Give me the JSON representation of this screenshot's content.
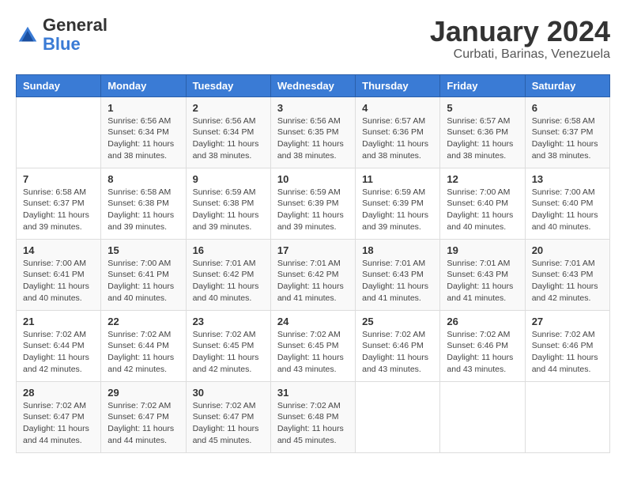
{
  "header": {
    "logo_general": "General",
    "logo_blue": "Blue",
    "month_title": "January 2024",
    "location": "Curbati, Barinas, Venezuela"
  },
  "weekdays": [
    "Sunday",
    "Monday",
    "Tuesday",
    "Wednesday",
    "Thursday",
    "Friday",
    "Saturday"
  ],
  "weeks": [
    [
      {
        "day": "",
        "info": ""
      },
      {
        "day": "1",
        "info": "Sunrise: 6:56 AM\nSunset: 6:34 PM\nDaylight: 11 hours\nand 38 minutes."
      },
      {
        "day": "2",
        "info": "Sunrise: 6:56 AM\nSunset: 6:34 PM\nDaylight: 11 hours\nand 38 minutes."
      },
      {
        "day": "3",
        "info": "Sunrise: 6:56 AM\nSunset: 6:35 PM\nDaylight: 11 hours\nand 38 minutes."
      },
      {
        "day": "4",
        "info": "Sunrise: 6:57 AM\nSunset: 6:36 PM\nDaylight: 11 hours\nand 38 minutes."
      },
      {
        "day": "5",
        "info": "Sunrise: 6:57 AM\nSunset: 6:36 PM\nDaylight: 11 hours\nand 38 minutes."
      },
      {
        "day": "6",
        "info": "Sunrise: 6:58 AM\nSunset: 6:37 PM\nDaylight: 11 hours\nand 38 minutes."
      }
    ],
    [
      {
        "day": "7",
        "info": "Sunrise: 6:58 AM\nSunset: 6:37 PM\nDaylight: 11 hours\nand 39 minutes."
      },
      {
        "day": "8",
        "info": "Sunrise: 6:58 AM\nSunset: 6:38 PM\nDaylight: 11 hours\nand 39 minutes."
      },
      {
        "day": "9",
        "info": "Sunrise: 6:59 AM\nSunset: 6:38 PM\nDaylight: 11 hours\nand 39 minutes."
      },
      {
        "day": "10",
        "info": "Sunrise: 6:59 AM\nSunset: 6:39 PM\nDaylight: 11 hours\nand 39 minutes."
      },
      {
        "day": "11",
        "info": "Sunrise: 6:59 AM\nSunset: 6:39 PM\nDaylight: 11 hours\nand 39 minutes."
      },
      {
        "day": "12",
        "info": "Sunrise: 7:00 AM\nSunset: 6:40 PM\nDaylight: 11 hours\nand 40 minutes."
      },
      {
        "day": "13",
        "info": "Sunrise: 7:00 AM\nSunset: 6:40 PM\nDaylight: 11 hours\nand 40 minutes."
      }
    ],
    [
      {
        "day": "14",
        "info": "Sunrise: 7:00 AM\nSunset: 6:41 PM\nDaylight: 11 hours\nand 40 minutes."
      },
      {
        "day": "15",
        "info": "Sunrise: 7:00 AM\nSunset: 6:41 PM\nDaylight: 11 hours\nand 40 minutes."
      },
      {
        "day": "16",
        "info": "Sunrise: 7:01 AM\nSunset: 6:42 PM\nDaylight: 11 hours\nand 40 minutes."
      },
      {
        "day": "17",
        "info": "Sunrise: 7:01 AM\nSunset: 6:42 PM\nDaylight: 11 hours\nand 41 minutes."
      },
      {
        "day": "18",
        "info": "Sunrise: 7:01 AM\nSunset: 6:43 PM\nDaylight: 11 hours\nand 41 minutes."
      },
      {
        "day": "19",
        "info": "Sunrise: 7:01 AM\nSunset: 6:43 PM\nDaylight: 11 hours\nand 41 minutes."
      },
      {
        "day": "20",
        "info": "Sunrise: 7:01 AM\nSunset: 6:43 PM\nDaylight: 11 hours\nand 42 minutes."
      }
    ],
    [
      {
        "day": "21",
        "info": "Sunrise: 7:02 AM\nSunset: 6:44 PM\nDaylight: 11 hours\nand 42 minutes."
      },
      {
        "day": "22",
        "info": "Sunrise: 7:02 AM\nSunset: 6:44 PM\nDaylight: 11 hours\nand 42 minutes."
      },
      {
        "day": "23",
        "info": "Sunrise: 7:02 AM\nSunset: 6:45 PM\nDaylight: 11 hours\nand 42 minutes."
      },
      {
        "day": "24",
        "info": "Sunrise: 7:02 AM\nSunset: 6:45 PM\nDaylight: 11 hours\nand 43 minutes."
      },
      {
        "day": "25",
        "info": "Sunrise: 7:02 AM\nSunset: 6:46 PM\nDaylight: 11 hours\nand 43 minutes."
      },
      {
        "day": "26",
        "info": "Sunrise: 7:02 AM\nSunset: 6:46 PM\nDaylight: 11 hours\nand 43 minutes."
      },
      {
        "day": "27",
        "info": "Sunrise: 7:02 AM\nSunset: 6:46 PM\nDaylight: 11 hours\nand 44 minutes."
      }
    ],
    [
      {
        "day": "28",
        "info": "Sunrise: 7:02 AM\nSunset: 6:47 PM\nDaylight: 11 hours\nand 44 minutes."
      },
      {
        "day": "29",
        "info": "Sunrise: 7:02 AM\nSunset: 6:47 PM\nDaylight: 11 hours\nand 44 minutes."
      },
      {
        "day": "30",
        "info": "Sunrise: 7:02 AM\nSunset: 6:47 PM\nDaylight: 11 hours\nand 45 minutes."
      },
      {
        "day": "31",
        "info": "Sunrise: 7:02 AM\nSunset: 6:48 PM\nDaylight: 11 hours\nand 45 minutes."
      },
      {
        "day": "",
        "info": ""
      },
      {
        "day": "",
        "info": ""
      },
      {
        "day": "",
        "info": ""
      }
    ]
  ]
}
